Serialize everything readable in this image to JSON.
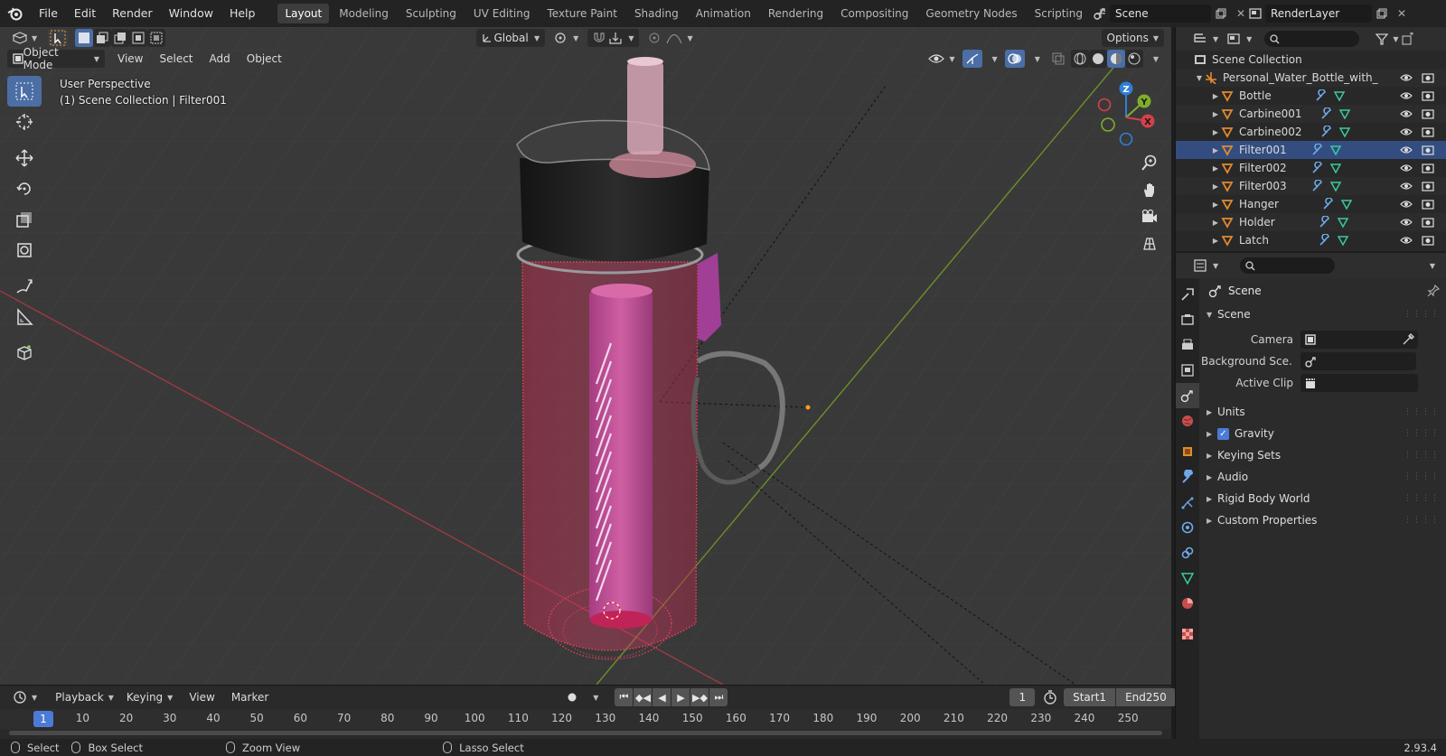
{
  "menu": [
    "File",
    "Edit",
    "Render",
    "Window",
    "Help"
  ],
  "workspaces": [
    "Layout",
    "Modeling",
    "Sculpting",
    "UV Editing",
    "Texture Paint",
    "Shading",
    "Animation",
    "Rendering",
    "Compositing",
    "Geometry Nodes",
    "Scripting"
  ],
  "active_workspace": "Layout",
  "scene_name": "Scene",
  "view_layer": "RenderLayer",
  "viewport": {
    "mode": "Object Mode",
    "menus": [
      "View",
      "Select",
      "Add",
      "Object"
    ],
    "transform_orientation": "Global",
    "options_label": "Options",
    "info_line1": "User Perspective",
    "info_line2": "(1) Scene Collection | Filter001",
    "gizmo": {
      "z": "Z",
      "y": "Y",
      "x": "X"
    }
  },
  "timeline": {
    "menus": [
      "Playback",
      "Keying",
      "View",
      "Marker"
    ],
    "current_frame": "1",
    "start_label": "Start",
    "start_value": "1",
    "end_label": "End",
    "end_value": "250",
    "frame_ticks": [
      "10",
      "20",
      "30",
      "40",
      "50",
      "60",
      "70",
      "80",
      "90",
      "100",
      "110",
      "120",
      "130",
      "140",
      "150",
      "160",
      "170",
      "180",
      "190",
      "200",
      "210",
      "220",
      "230",
      "240",
      "250"
    ],
    "current_marker": "1"
  },
  "status": {
    "select": "Select",
    "box_select": "Box Select",
    "zoom_view": "Zoom View",
    "lasso_select": "Lasso Select",
    "version": "2.93.4"
  },
  "outliner": {
    "root": "Scene Collection",
    "parent": "Personal_Water_Bottle_with_",
    "items": [
      "Bottle",
      "Carbine001",
      "Carbine002",
      "Filter001",
      "Filter002",
      "Filter003",
      "Hanger",
      "Holder",
      "Latch"
    ],
    "selected": "Filter001"
  },
  "properties": {
    "title": "Scene",
    "panel_scene": "Scene",
    "camera_label": "Camera",
    "bg_scene_label": "Background Sce...",
    "active_clip_label": "Active Clip",
    "panels": [
      "Units",
      "Gravity",
      "Keying Sets",
      "Audio",
      "Rigid Body World",
      "Custom Properties"
    ]
  },
  "colors": {
    "accent": "#4b7bd6",
    "selection": "#4b6ea5",
    "x_axis": "#d5404b",
    "y_axis": "#7fae2c",
    "z_axis": "#2f7fd9",
    "object_orange": "#e38a2e",
    "mesh_green": "#3bc9a0",
    "wrench_blue": "#6fa9e8"
  }
}
